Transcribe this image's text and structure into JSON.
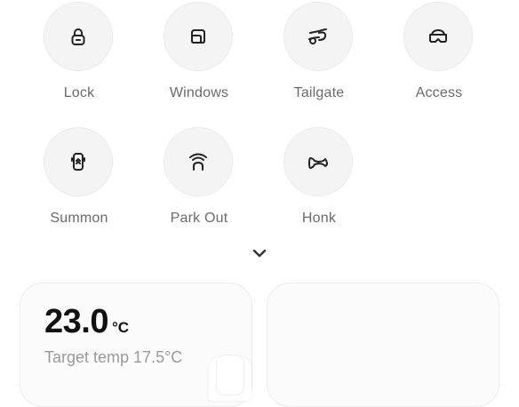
{
  "controls": [
    {
      "label": "Lock",
      "icon": "lock-icon"
    },
    {
      "label": "Windows",
      "icon": "window-icon"
    },
    {
      "label": "Tailgate",
      "icon": "tailgate-icon"
    },
    {
      "label": "Access",
      "icon": "access-goggles-icon"
    },
    {
      "label": "Summon",
      "icon": "summon-icon"
    },
    {
      "label": "Park Out",
      "icon": "park-out-icon"
    },
    {
      "label": "Honk",
      "icon": "horn-icon"
    }
  ],
  "expand": {
    "icon": "chevron-down-icon"
  },
  "climate": {
    "temp": "23.0",
    "unit": "°C",
    "target": "Target temp 17.5°C"
  },
  "colors": {
    "label": "#6a6a6a",
    "icon": "#222222",
    "circle_bg": "#f4f4f4",
    "card_bg": "#fbfbfb"
  }
}
